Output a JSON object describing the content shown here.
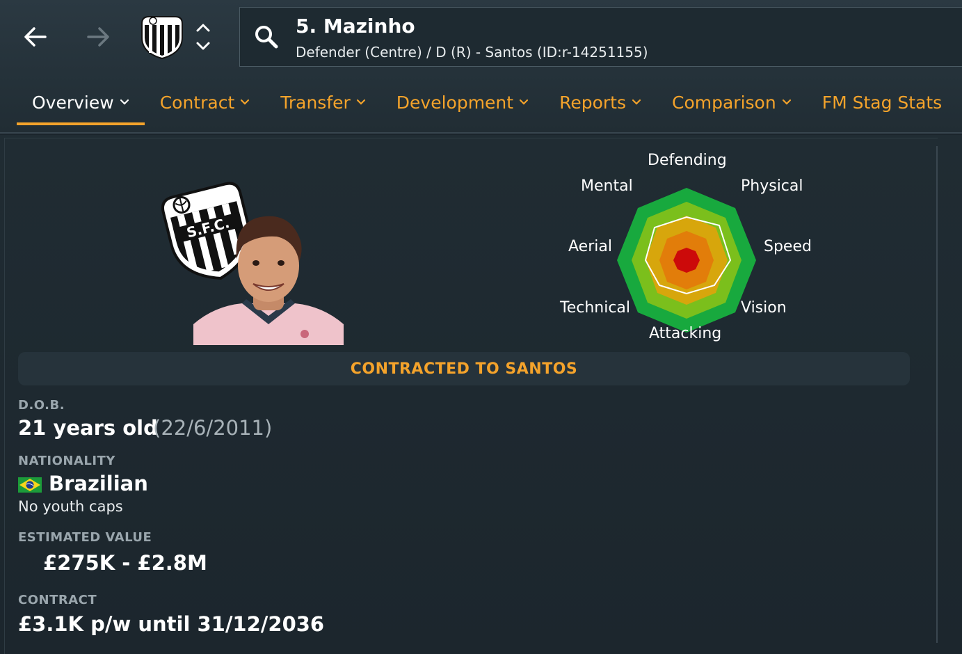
{
  "header": {
    "player_title": "5. Mazinho",
    "player_subtitle": "Defender (Centre) / D (R) - Santos (ID:r-14251155)"
  },
  "tabs": [
    {
      "label": "Overview",
      "active": true
    },
    {
      "label": "Contract"
    },
    {
      "label": "Transfer"
    },
    {
      "label": "Development"
    },
    {
      "label": "Reports"
    },
    {
      "label": "Comparison"
    },
    {
      "label": "FM Stag Stats"
    }
  ],
  "radar": {
    "labels": {
      "defending": "Defending",
      "physical": "Physical",
      "speed": "Speed",
      "vision": "Vision",
      "attacking": "Attacking",
      "technical": "Technical",
      "aerial": "Aerial",
      "mental": "Mental"
    }
  },
  "banner": "CONTRACTED TO SANTOS",
  "dob": {
    "label": "D.O.B.",
    "age": "21 years old",
    "date": "(22/6/2011)"
  },
  "nationality": {
    "label": "NATIONALITY",
    "value": "Brazilian",
    "youth_caps": "No youth caps"
  },
  "estimated_value": {
    "label": "ESTIMATED VALUE",
    "value": "£275K - £2.8M"
  },
  "contract": {
    "label": "CONTRACT",
    "value": "£3.1K p/w until 31/12/2036"
  },
  "colors": {
    "accent": "#f4a32b",
    "background": "#1b252c"
  }
}
